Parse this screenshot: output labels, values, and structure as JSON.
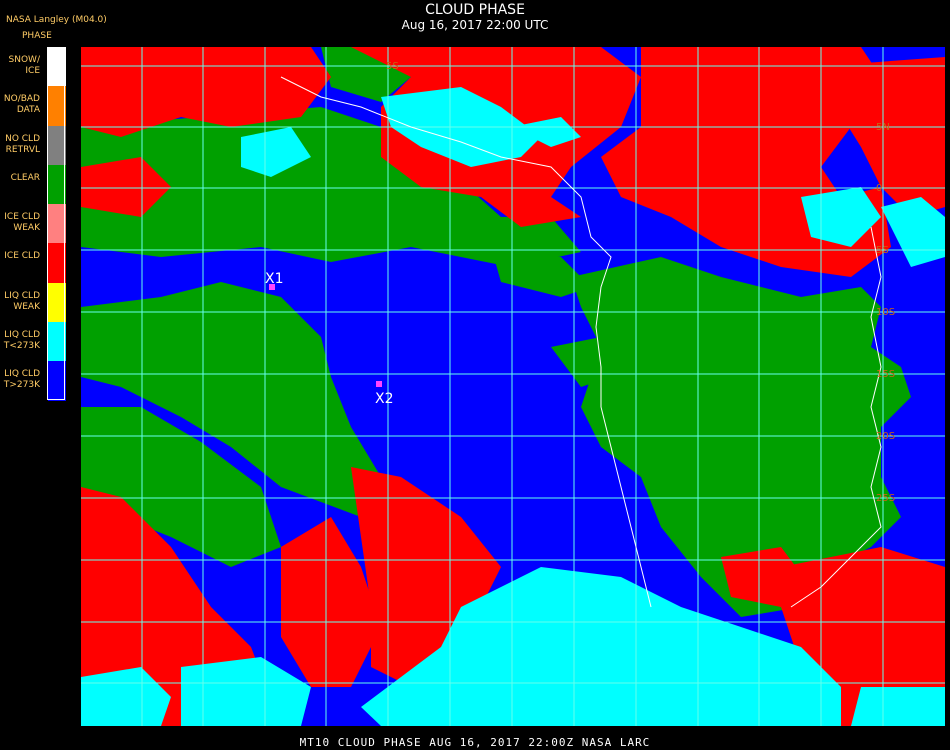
{
  "credit": "NASA Langley (M04.0)",
  "title": "CLOUD PHASE",
  "subtitle": "Aug 16, 2017 22:00 UTC",
  "legend": {
    "heading": "PHASE",
    "items": [
      {
        "label": "SNOW/\nICE",
        "color": "#ffffff"
      },
      {
        "label": "NO/BAD\nDATA",
        "color": "#ff8000"
      },
      {
        "label": "NO CLD\nRETRVL",
        "color": "#808080"
      },
      {
        "label": "CLEAR",
        "color": "#00a000"
      },
      {
        "label": "ICE CLD\nWEAK",
        "color": "#ff8080"
      },
      {
        "label": "ICE CLD",
        "color": "#ff0000"
      },
      {
        "label": "LIQ CLD\nWEAK",
        "color": "#ffff00"
      },
      {
        "label": "LIQ CLD\nT<273K",
        "color": "#00ffff"
      },
      {
        "label": "LIQ CLD\nT>273K",
        "color": "#0000ff"
      }
    ]
  },
  "map": {
    "lat_labels": [
      "5S",
      "5N",
      "0",
      "5S",
      "10S",
      "15S",
      "20S",
      "25S"
    ],
    "markers": [
      {
        "label": "X1",
        "color": "#ff44ff"
      },
      {
        "label": "X2",
        "color": "#ff44ff"
      }
    ],
    "grid_color": "#66ffee",
    "coast_color": "#ffffff"
  },
  "footer": "MT10  CLOUD PHASE   AUG 16, 2017 22:00Z   NASA LARC"
}
